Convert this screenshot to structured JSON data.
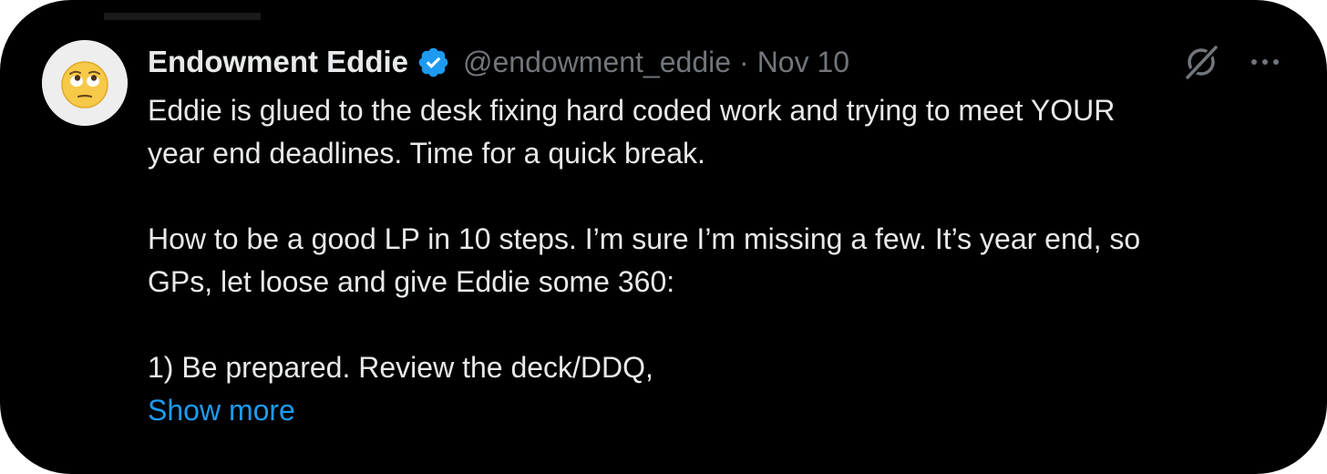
{
  "tweet": {
    "author": {
      "display_name": "Endowment Eddie",
      "handle": "@endowment_eddie",
      "verified": true,
      "avatar_icon": "eye-roll-emoji-icon"
    },
    "separator": "·",
    "date": "Nov 10",
    "body": {
      "line1": "Eddie is glued to the desk fixing hard coded work and trying to meet YOUR",
      "line2": "year end deadlines. Time for a quick break.",
      "line3": "How to be a good LP in 10 steps. I’m sure I’m missing a few. It’s year end, so",
      "line4": "GPs, let loose and give Eddie some 360:",
      "line5": "1) Be prepared. Review the deck/DDQ,"
    },
    "show_more_label": "Show more",
    "icons": {
      "verified": "verified-badge-icon",
      "grok": "grok-icon",
      "more": "more-options-icon"
    },
    "colors": {
      "background": "#000000",
      "text": "#e7e9ea",
      "secondary": "#71767b",
      "link": "#1d9bf0",
      "verified": "#1d9bf0"
    }
  }
}
